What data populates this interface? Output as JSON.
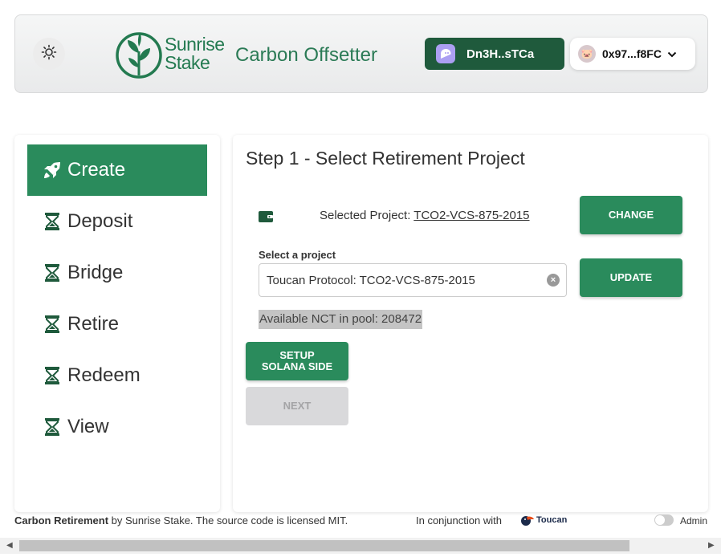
{
  "header": {
    "logo_line1": "Sunrise",
    "logo_line2": "Stake",
    "title": "Carbon Offsetter",
    "solana_wallet": "Dn3H..sTCa",
    "eth_wallet": "0x97...f8FC"
  },
  "sidebar": {
    "items": [
      {
        "label": "Create",
        "icon": "rocket-icon",
        "active": true
      },
      {
        "label": "Deposit",
        "icon": "hourglass-icon"
      },
      {
        "label": "Bridge",
        "icon": "hourglass-icon"
      },
      {
        "label": "Retire",
        "icon": "hourglass-icon"
      },
      {
        "label": "Redeem",
        "icon": "hourglass-icon"
      },
      {
        "label": "View",
        "icon": "hourglass-icon"
      }
    ]
  },
  "main": {
    "step_title": "Step 1 - Select Retirement Project",
    "selected_prefix": "Selected Project: ",
    "selected_project": "TCO2-VCS-875-2015",
    "change_label": "CHANGE",
    "select_label": "Select a project",
    "select_value": "Toucan Protocol: TCO2-VCS-875-2015",
    "update_label": "UPDATE",
    "available_text": "Available NCT in pool: 208472",
    "setup_label_1": "SETUP",
    "setup_label_2": "SOLANA SIDE",
    "next_label": "NEXT"
  },
  "footer": {
    "brand": "Carbon Retirement",
    "text": " by Sunrise Stake. The source code is licensed MIT.",
    "conjunction": "In conjunction with",
    "toucan": "Toucan",
    "admin": "Admin"
  },
  "colors": {
    "accent": "#2a8b5c",
    "dark_green": "#1f5a3c",
    "disabled": "#d9d9db"
  }
}
